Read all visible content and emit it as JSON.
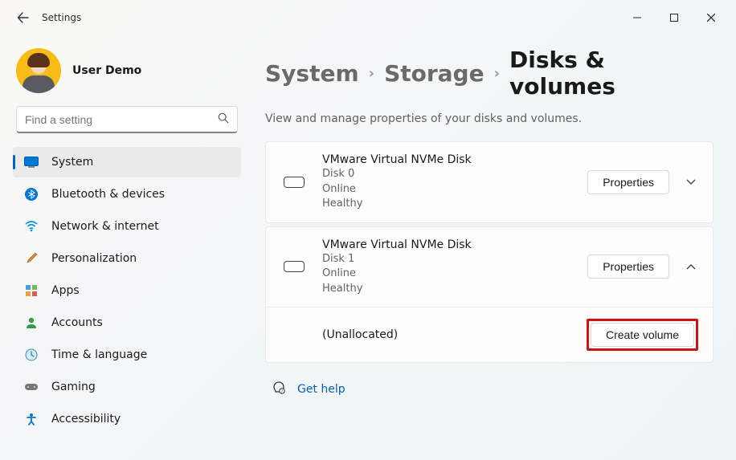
{
  "window": {
    "title": "Settings"
  },
  "profile": {
    "name": "User Demo"
  },
  "search": {
    "placeholder": "Find a setting"
  },
  "sidebar": {
    "items": [
      {
        "label": "System",
        "icon": "display-icon",
        "active": true
      },
      {
        "label": "Bluetooth & devices",
        "icon": "bluetooth-icon"
      },
      {
        "label": "Network & internet",
        "icon": "wifi-icon"
      },
      {
        "label": "Personalization",
        "icon": "brush-icon"
      },
      {
        "label": "Apps",
        "icon": "apps-icon"
      },
      {
        "label": "Accounts",
        "icon": "person-icon"
      },
      {
        "label": "Time & language",
        "icon": "clock-icon"
      },
      {
        "label": "Gaming",
        "icon": "gamepad-icon"
      },
      {
        "label": "Accessibility",
        "icon": "accessibility-icon"
      }
    ]
  },
  "breadcrumb": {
    "parts": [
      "System",
      "Storage",
      "Disks & volumes"
    ]
  },
  "subtitle": "View and manage properties of your disks and volumes.",
  "disks": [
    {
      "name": "VMware Virtual NVMe Disk",
      "id": "Disk 0",
      "status1": "Online",
      "status2": "Healthy",
      "button": "Properties",
      "expanded": false
    },
    {
      "name": "VMware Virtual NVMe Disk",
      "id": "Disk 1",
      "status1": "Online",
      "status2": "Healthy",
      "button": "Properties",
      "expanded": true,
      "subrow": {
        "label": "(Unallocated)",
        "button": "Create volume"
      }
    }
  ],
  "help": {
    "label": "Get help"
  }
}
